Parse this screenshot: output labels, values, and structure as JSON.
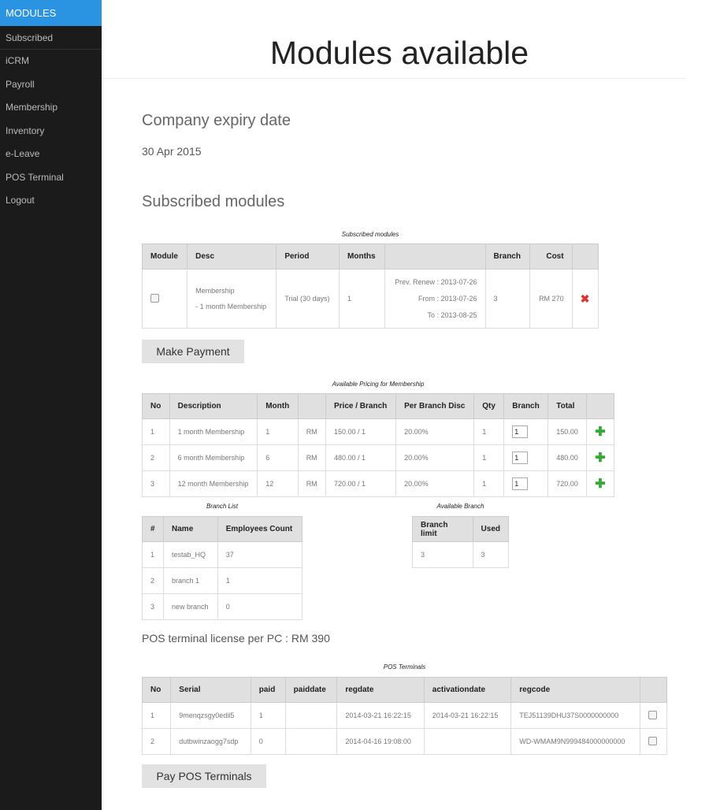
{
  "sidebar": {
    "brand": "MODULES",
    "items": [
      {
        "label": "Subscribed"
      },
      {
        "label": "iCRM"
      },
      {
        "label": "Payroll"
      },
      {
        "label": "Membership"
      },
      {
        "label": "Inventory"
      },
      {
        "label": "e-Leave"
      },
      {
        "label": "POS Terminal"
      },
      {
        "label": "Logout"
      }
    ]
  },
  "header": {
    "title": "Modules available"
  },
  "expiry": {
    "heading": "Company expiry date",
    "date": "30 Apr 2015"
  },
  "subscribed": {
    "heading": "Subscribed modules",
    "caption": "Subscribed modules",
    "columns": [
      "Module",
      "Desc",
      "Period",
      "Months",
      "",
      "Branch",
      "Cost",
      ""
    ],
    "row": {
      "desc1": "Membership",
      "desc2": "- 1 month Membership",
      "period": "Trial (30 days)",
      "months": "1",
      "prev": "Prev. Renew : 2013-07-26",
      "from": "From : 2013-07-26",
      "to": "To : 2013-08-25",
      "branch": "3",
      "cost": "RM 270",
      "remove_icon": "✖"
    }
  },
  "make_payment": "Make Payment",
  "pricing": {
    "caption": "Available Pricing for Membership",
    "columns": [
      "No",
      "Description",
      "Month",
      "",
      "Price / Branch",
      "Per Branch Disc",
      "Qty",
      "Branch",
      "Total",
      ""
    ],
    "rows": [
      {
        "no": "1",
        "desc": "1 month Membership",
        "month": "1",
        "cur": "RM",
        "price": "150.00 / 1",
        "disc": "20.00%",
        "qty": "1",
        "branch": "1",
        "total": "150.00"
      },
      {
        "no": "2",
        "desc": "6 month Membership",
        "month": "6",
        "cur": "RM",
        "price": "480.00 / 1",
        "disc": "20.00%",
        "qty": "1",
        "branch": "1",
        "total": "480.00"
      },
      {
        "no": "3",
        "desc": "12 month Membership",
        "month": "12",
        "cur": "RM",
        "price": "720.00 / 1",
        "disc": "20.00%",
        "qty": "1",
        "branch": "1",
        "total": "720.00"
      }
    ],
    "add_icon": "✚"
  },
  "branch_list": {
    "caption": "Branch List",
    "columns": [
      "#",
      "Name",
      "Employees Count"
    ],
    "rows": [
      {
        "no": "1",
        "name": "testab_HQ",
        "count": "37"
      },
      {
        "no": "2",
        "name": "branch 1",
        "count": "1"
      },
      {
        "no": "3",
        "name": "new branch",
        "count": "0"
      }
    ]
  },
  "available_branch": {
    "caption": "Available Branch",
    "columns": [
      "Branch limit",
      "Used"
    ],
    "limit": "3",
    "used": "3"
  },
  "pos_license": "POS terminal license per PC : RM 390",
  "pos": {
    "caption": "POS Terminals",
    "columns": [
      "No",
      "Serial",
      "paid",
      "paiddate",
      "regdate",
      "activationdate",
      "regcode",
      ""
    ],
    "rows": [
      {
        "no": "1",
        "serial": "9menqzsgy0edil5",
        "paid": "1",
        "paiddate": "",
        "regdate": "2014-03-21 16:22:15",
        "activationdate": "2014-03-21 16:22:15",
        "regcode": "TEJ51139DHU37S0000000000"
      },
      {
        "no": "2",
        "serial": "dutbwinzaogg7sdp",
        "paid": "0",
        "paiddate": "",
        "regdate": "2014-04-16 19:08:00",
        "activationdate": "",
        "regcode": "WD-WMAM9N999484000000000"
      }
    ]
  },
  "pay_pos": "Pay POS Terminals"
}
